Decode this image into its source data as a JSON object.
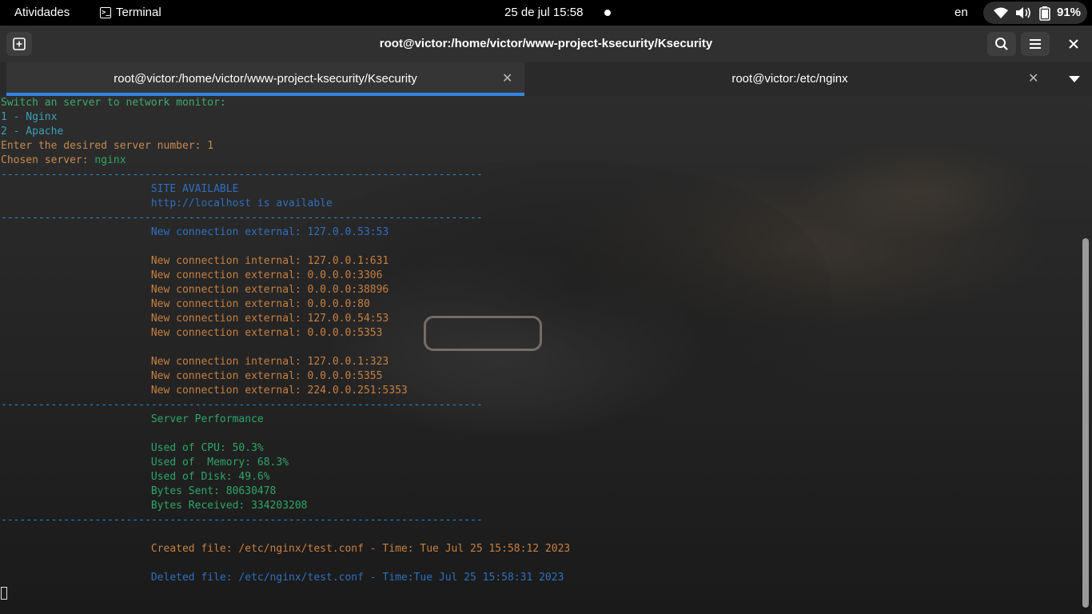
{
  "topbar": {
    "activities": "Atividades",
    "app_name": "Terminal",
    "clock": "25 de jul  15:58",
    "language": "en",
    "battery_percent": "91%"
  },
  "headerbar": {
    "title": "root@victor:/home/victor/www-project-ksecurity/Ksecurity"
  },
  "tabs": [
    {
      "label": "root@victor:/home/victor/www-project-ksecurity/Ksecurity",
      "active": true
    },
    {
      "label": "root@victor:/etc/nginx",
      "active": false
    }
  ],
  "terminal": {
    "lines": [
      {
        "text": "Switch an server to network monitor:",
        "style": "prompt"
      },
      {
        "text": "1 - Nginx",
        "style": "item"
      },
      {
        "text": "2 - Apache",
        "style": "item"
      },
      {
        "text": "Enter the desired server number: 1",
        "style": "ask"
      },
      {
        "text": "Chosen server: ",
        "style": "ask",
        "accent": "nginx",
        "accent_style": "ok"
      },
      {
        "text": "-----------------------------------------------------------------------------",
        "style": "sep"
      },
      {
        "text": "                        SITE AVAILABLE",
        "style": "blue"
      },
      {
        "text": "                        http://localhost is available",
        "style": "blue"
      },
      {
        "text": "-----------------------------------------------------------------------------",
        "style": "sep"
      },
      {
        "text": "                        New connection external: 127.0.0.53:53",
        "style": "blue"
      },
      {
        "text": "",
        "style": "blue"
      },
      {
        "text": "                        New connection internal: 127.0.0.1:631",
        "style": "orange"
      },
      {
        "text": "                        New connection external: 0.0.0.0:3306",
        "style": "orange"
      },
      {
        "text": "                        New connection external: 0.0.0.0:38896",
        "style": "orange"
      },
      {
        "text": "                        New connection external: 0.0.0.0:80",
        "style": "orange"
      },
      {
        "text": "                        New connection external: 127.0.0.54:53",
        "style": "orange"
      },
      {
        "text": "                        New connection external: 0.0.0.0:5353",
        "style": "orange"
      },
      {
        "text": "",
        "style": "orange"
      },
      {
        "text": "                        New connection internal: 127.0.0.1:323",
        "style": "orange"
      },
      {
        "text": "                        New connection external: 0.0.0.0:5355",
        "style": "orange"
      },
      {
        "text": "                        New connection external: 224.0.0.251:5353",
        "style": "orange"
      },
      {
        "text": "-----------------------------------------------------------------------------",
        "style": "sep"
      },
      {
        "text": "                        Server Performance",
        "style": "green"
      },
      {
        "text": "",
        "style": "green"
      },
      {
        "text": "                        Used of CPU: 50.3%",
        "style": "green"
      },
      {
        "text": "                        Used of  Memory: 68.3%",
        "style": "green"
      },
      {
        "text": "                        Used of Disk: 49.6%",
        "style": "green"
      },
      {
        "text": "                        Bytes Sent: 80630478",
        "style": "green"
      },
      {
        "text": "                        Bytes Received: 334203208",
        "style": "green"
      },
      {
        "text": "-----------------------------------------------------------------------------",
        "style": "sep"
      },
      {
        "text": "",
        "style": "orange"
      },
      {
        "text": "                        Created file: /etc/nginx/test.conf - Time: Tue Jul 25 15:58:12 2023",
        "style": "orange"
      },
      {
        "text": "",
        "style": "blue"
      },
      {
        "text": "                        Deleted file: /etc/nginx/test.conf - Time:Tue Jul 25 15:58:31 2023",
        "style": "blue"
      }
    ]
  },
  "colors": {
    "accent": "#3584e4",
    "text_green": "#2ea56a",
    "text_orange": "#c77f40",
    "text_blue": "#2f6fc0"
  }
}
